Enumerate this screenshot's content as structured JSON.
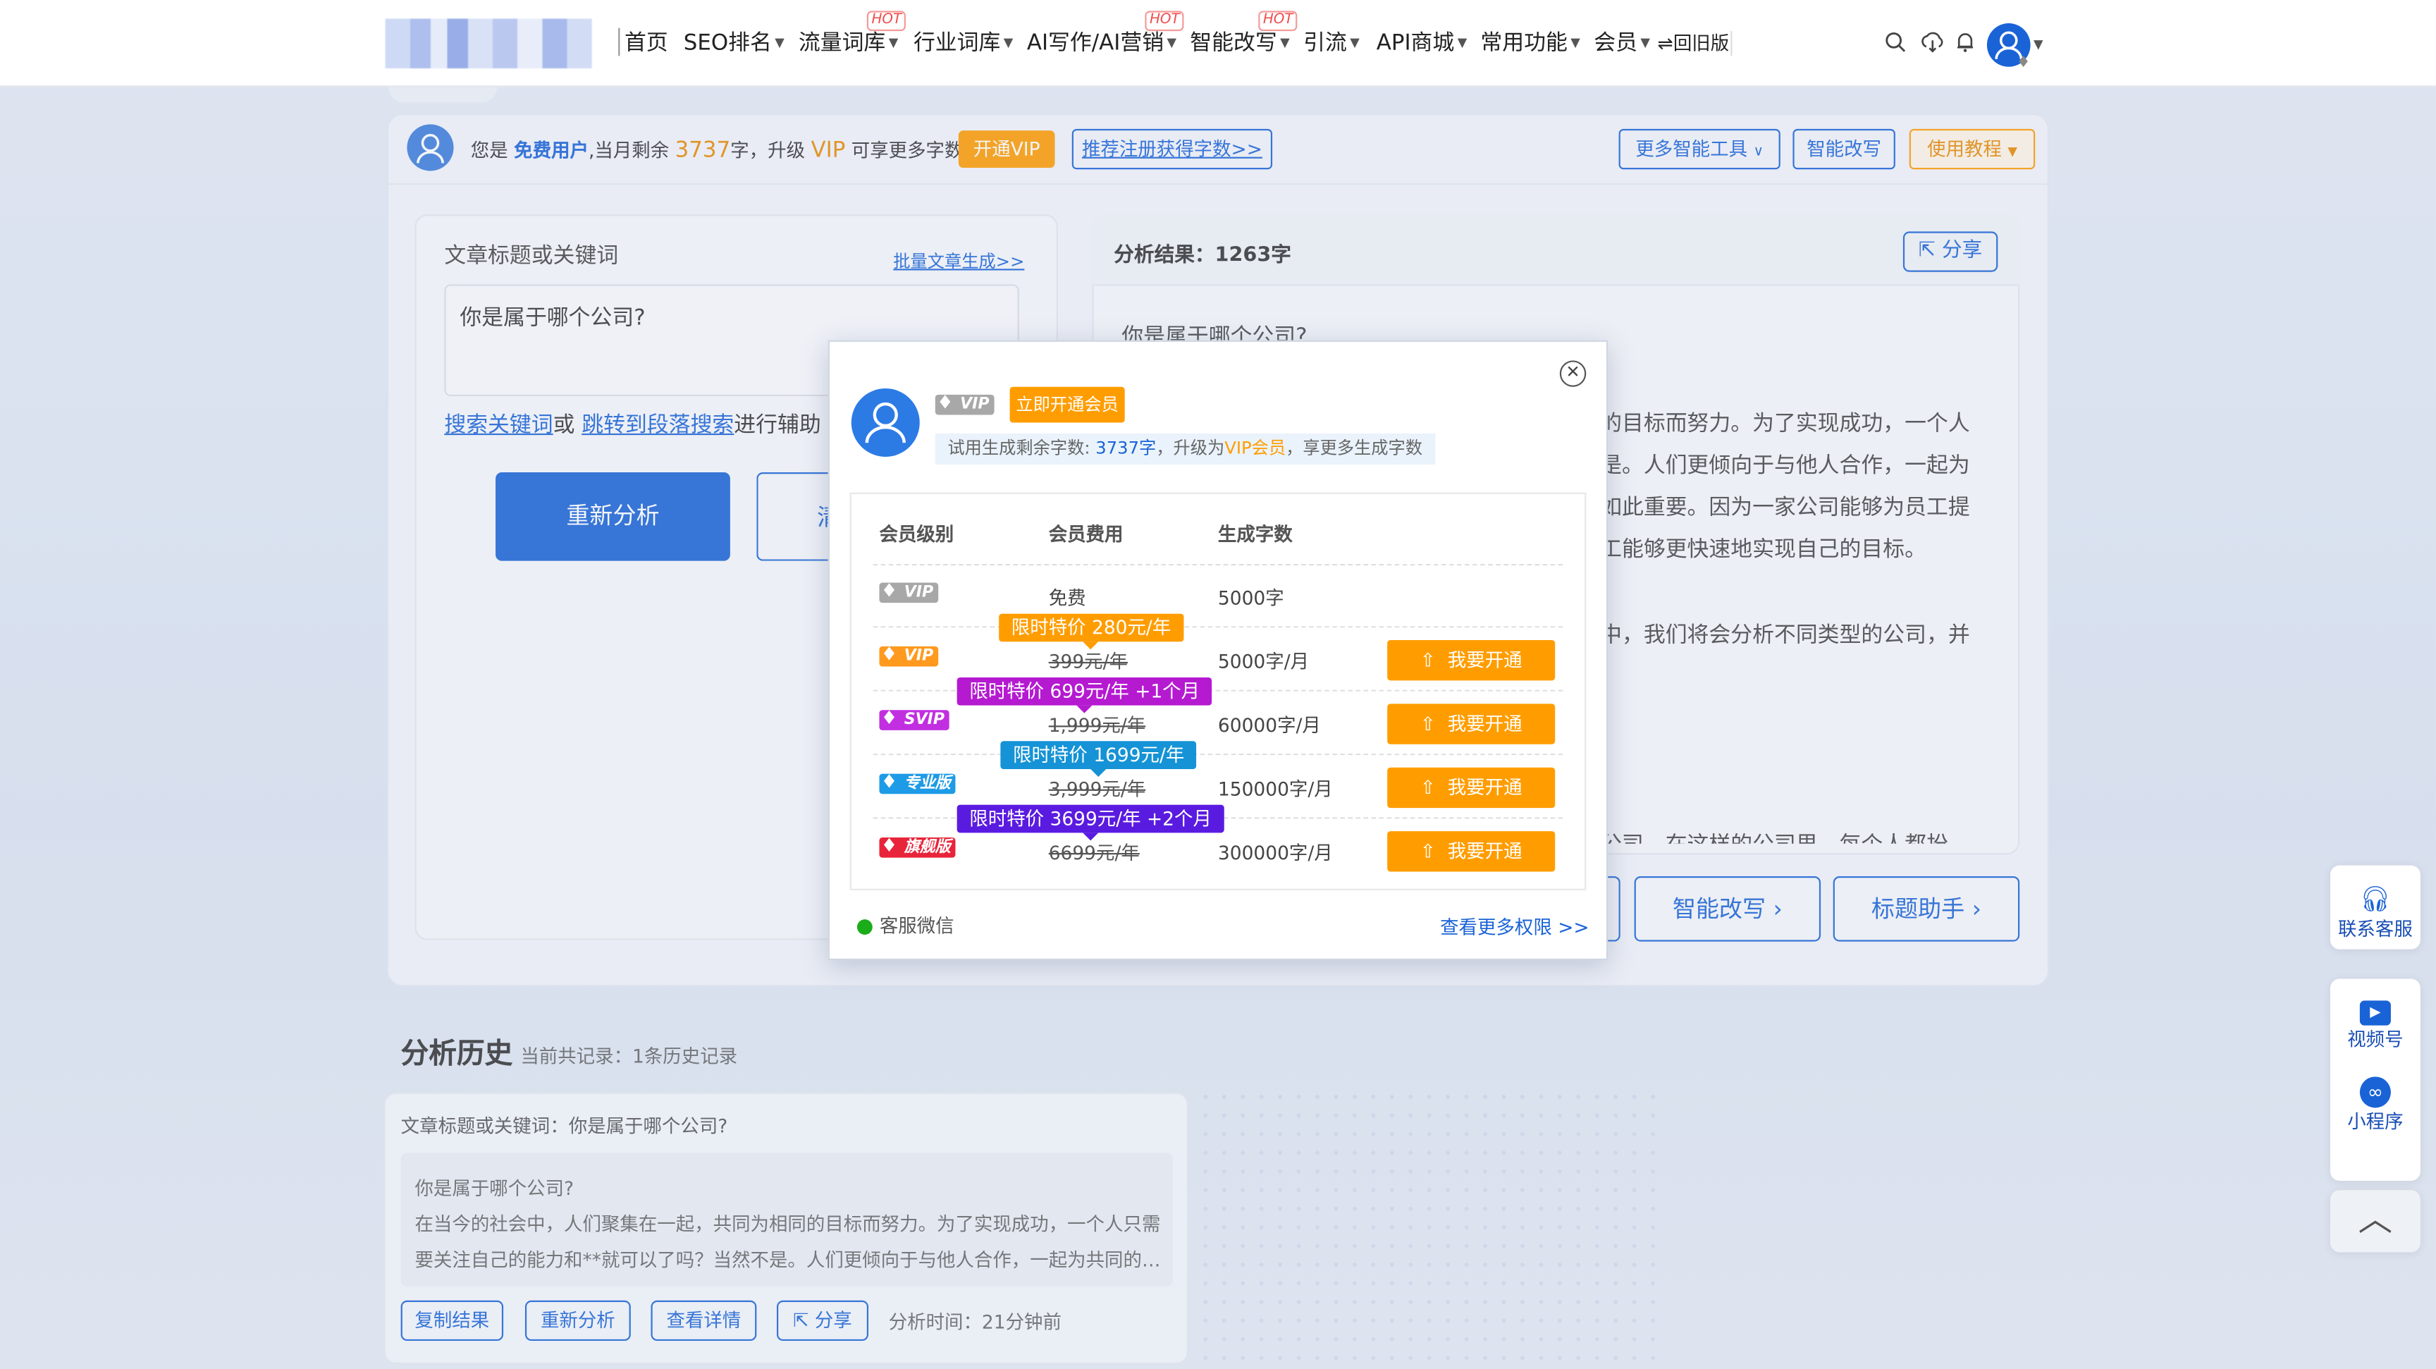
{
  "nav": {
    "items": [
      {
        "label": "首页",
        "hot": false,
        "caret": false
      },
      {
        "label": "SEO排名",
        "hot": false,
        "caret": true
      },
      {
        "label": "流量词库",
        "hot": true,
        "caret": true
      },
      {
        "label": "行业词库",
        "hot": false,
        "caret": true
      },
      {
        "label": "AI写作/AI营销",
        "hot": true,
        "caret": true
      },
      {
        "label": "智能改写",
        "hot": true,
        "caret": true
      },
      {
        "label": "引流",
        "hot": false,
        "caret": true
      },
      {
        "label": "API商城",
        "hot": false,
        "caret": true
      },
      {
        "label": "常用功能",
        "hot": false,
        "caret": true
      },
      {
        "label": "会员",
        "hot": false,
        "caret": true
      }
    ],
    "hot_label": "HOT",
    "old_version": "⇌回旧版"
  },
  "userbar": {
    "prefix": "您是",
    "user_type": "免费用户",
    "remain_text": ",当月剩余",
    "remain_count": "3737",
    "remain_suffix": "字，升级",
    "vip": "VIP",
    "more_text": "可享更多字数",
    "open_vip": "开通VIP",
    "recommend": "推荐注册获得字数>>",
    "more_tools": "更多智能工具",
    "smart_rewrite": "智能改写",
    "tutorial": "使用教程"
  },
  "left_panel": {
    "label": "文章标题或关键词",
    "batch_link": "批量文章生成>>",
    "input_value": "你是属于哪个公司?",
    "help_link1": "搜索关键词",
    "help_or": "或",
    "help_link2": "跳转到段落搜索",
    "help_rest": "进行辅助",
    "reanalyze": "重新分析",
    "second_btn_partial": "清"
  },
  "right_panel": {
    "result_label": "分析结果：1263字",
    "share": "分享",
    "title_line": "你是属于哪个公司?",
    "lines": [
      "的目标而努力。为了实现成功，一个人",
      "是。人们更倾向于与他人合作，一起为",
      "如此重要。因为一家公司能够为员工提",
      "工能够更快速地实现自己的目标。",
      "中，我们将会分析不同类型的公司，并",
      "公司，在这样的公司里，每个人都扮"
    ],
    "btn_rewrite": "智能改写",
    "btn_title": "标题助手"
  },
  "history": {
    "title": "分析历史",
    "count_text": "当前共记录：1条历史记录",
    "kw_label": "文章标题或关键词：",
    "kw_value": "你是属于哪个公司?",
    "preview_title": "你是属于哪个公司?",
    "preview_line1": "在当今的社会中，人们聚集在一起，共同为相同的目标而努力。为了实现成功，一个人只需",
    "preview_line2": "要关注自己的能力和**就可以了吗？当然不是。人们更倾向于与他人合作，一起为共同的…",
    "copy": "复制结果",
    "reanalyze": "重新分析",
    "details": "查看详情",
    "share": "分享",
    "time": "分析时间：21分钟前"
  },
  "modal": {
    "vip_tag": "VIP",
    "open_member": "立即开通会员",
    "trial_prefix": "试用生成剩余字数:",
    "trial_count": "3737字",
    "trial_mid": "，升级为",
    "trial_vip": "VIP会员",
    "trial_suffix": "，享更多生成字数",
    "headers": [
      "会员级别",
      "会员费用",
      "生成字数"
    ],
    "rows": [
      {
        "badge": "VIP",
        "badge_color": "#a7a7a7",
        "price": "免费",
        "strike": false,
        "words": "5000字",
        "tip": "",
        "tip_color": "",
        "button": ""
      },
      {
        "badge": "VIP",
        "badge_color": "#ff9a1f",
        "price": "399元/年",
        "strike": true,
        "words": "5000字/月",
        "tip": "限时特价 280元/年",
        "tip_color": "#ff9d00",
        "button": "我要开通"
      },
      {
        "badge": "SVIP",
        "badge_color": "#c12fe0",
        "price": "1,999元/年",
        "strike": true,
        "words": "60000字/月",
        "tip": "限时特价 699元/年 +1个月",
        "tip_color": "#b51ad1",
        "button": "我要开通"
      },
      {
        "badge": "专业版",
        "badge_color": "#1e9be6",
        "price": "3,999元/年",
        "strike": true,
        "words": "150000字/月",
        "tip": "限时特价 1699元/年",
        "tip_color": "#1593d6",
        "button": "我要开通"
      },
      {
        "badge": "旗舰版",
        "badge_color": "#e8243a",
        "price": "6699元/年",
        "strike": true,
        "words": "300000字/月",
        "tip": "限时特价 3699元/年 +2个月",
        "tip_color": "#5a1be0",
        "button": "我要开通"
      }
    ],
    "wechat": "客服微信",
    "more_rights": "查看更多权限 >>"
  },
  "float": {
    "contact": "联系客服",
    "video": "视频号",
    "mini": "小程序"
  },
  "colors": {
    "primary": "#1a63d6",
    "orange": "#ff9d00",
    "hot": "#f04c4c"
  }
}
